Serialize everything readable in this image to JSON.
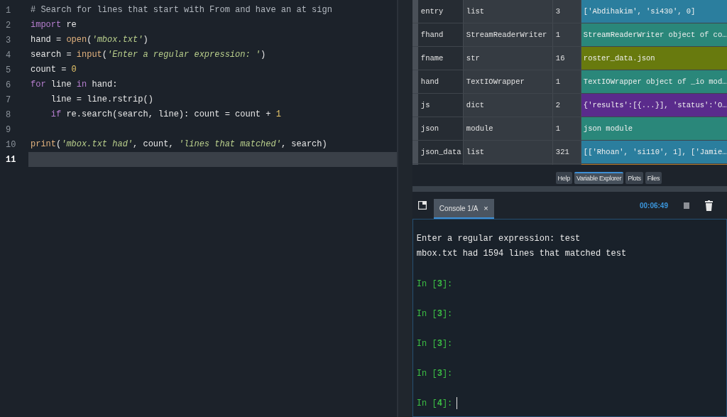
{
  "editor": {
    "lines": [
      {
        "number": "1",
        "selected": false,
        "tokens": [
          {
            "kind": "comment",
            "text": "# Search for lines that start with From and have an at sign"
          }
        ]
      },
      {
        "number": "2",
        "selected": false,
        "tokens": [
          {
            "kind": "keyword",
            "text": "import"
          },
          {
            "kind": "plain",
            "text": " re"
          }
        ]
      },
      {
        "number": "3",
        "selected": false,
        "tokens": [
          {
            "kind": "plain",
            "text": "hand = "
          },
          {
            "kind": "builtin",
            "text": "open"
          },
          {
            "kind": "plain",
            "text": "("
          },
          {
            "kind": "string",
            "text": "'mbox.txt'"
          },
          {
            "kind": "plain",
            "text": ")"
          }
        ]
      },
      {
        "number": "4",
        "selected": false,
        "tokens": [
          {
            "kind": "plain",
            "text": "search = "
          },
          {
            "kind": "builtin",
            "text": "input"
          },
          {
            "kind": "plain",
            "text": "("
          },
          {
            "kind": "string",
            "text": "'Enter a regular expression: '"
          },
          {
            "kind": "plain",
            "text": ")"
          }
        ]
      },
      {
        "number": "5",
        "selected": false,
        "tokens": [
          {
            "kind": "plain",
            "text": "count = "
          },
          {
            "kind": "number",
            "text": "0"
          }
        ]
      },
      {
        "number": "6",
        "selected": false,
        "tokens": [
          {
            "kind": "keyword",
            "text": "for"
          },
          {
            "kind": "plain",
            "text": " line "
          },
          {
            "kind": "keyword",
            "text": "in"
          },
          {
            "kind": "plain",
            "text": " hand:"
          }
        ]
      },
      {
        "number": "7",
        "selected": false,
        "tokens": [
          {
            "kind": "plain",
            "text": "    line = line.rstrip()"
          }
        ]
      },
      {
        "number": "8",
        "selected": false,
        "tokens": [
          {
            "kind": "keyword",
            "text": "    if"
          },
          {
            "kind": "plain",
            "text": " re.search(search, line): count = count + "
          },
          {
            "kind": "number",
            "text": "1"
          }
        ]
      },
      {
        "number": "9",
        "selected": false
      },
      {
        "number": "10",
        "selected": false,
        "tokens": [
          {
            "kind": "builtin",
            "text": "print"
          },
          {
            "kind": "plain",
            "text": "("
          },
          {
            "kind": "string",
            "text": "'mbox.txt had'"
          },
          {
            "kind": "plain",
            "text": ", count, "
          },
          {
            "kind": "string",
            "text": "'lines that matched'"
          },
          {
            "kind": "plain",
            "text": ", search)"
          }
        ]
      },
      {
        "number": "11",
        "selected": true
      }
    ]
  },
  "variable_explorer": {
    "rows": [
      {
        "name": "entry",
        "type": "list",
        "size": "3",
        "value": "['Abdihakim', 'si430', 0]",
        "color": "#2b7e9e"
      },
      {
        "name": "fhand",
        "type": "StreamReaderWriter",
        "size": "1",
        "value": "StreamReaderWriter object of co…",
        "color": "#2a877a"
      },
      {
        "name": "fname",
        "type": "str",
        "size": "16",
        "value": "roster_data.json",
        "color": "#687a0e"
      },
      {
        "name": "hand",
        "type": "TextIOWrapper",
        "size": "1",
        "value": "TextIOWrapper object of _io mod…",
        "color": "#2a877a"
      },
      {
        "name": "js",
        "type": "dict",
        "size": "2",
        "value": "{'results':[{...}], 'status':'O…",
        "color": "#5a2b8c"
      },
      {
        "name": "json",
        "type": "module",
        "size": "1",
        "value": "json module",
        "color": "#2a877a"
      },
      {
        "name": "json_data",
        "type": "list",
        "size": "321",
        "value": "[['Rhoan', 'si110', 1], ['Jamie…",
        "color": "#2b7e9e"
      },
      {
        "color": "#b07628"
      }
    ]
  },
  "pane_tabs": [
    {
      "label": "Help",
      "selected": false
    },
    {
      "label": "Variable Explorer",
      "selected": true
    },
    {
      "label": "Plots",
      "selected": false
    },
    {
      "label": "Files",
      "selected": false
    }
  ],
  "console": {
    "tab": {
      "label": "Console 1/A",
      "close": "×"
    },
    "elapsed": "00:06:49",
    "lines": [
      {
        "kind": "output",
        "text": "Enter a regular expression: test"
      },
      {
        "kind": "output",
        "text": "mbox.txt had 1594 lines that matched test"
      },
      {
        "kind": "prompt",
        "text": "In [**3**]:"
      },
      {
        "kind": "prompt",
        "text": "In [**3**]:"
      },
      {
        "kind": "prompt",
        "text": "In [**3**]:"
      },
      {
        "kind": "prompt",
        "text": "In [**3**]:"
      },
      {
        "kind": "prompt",
        "text": "In [**4**]:",
        "cursor": true
      }
    ]
  }
}
